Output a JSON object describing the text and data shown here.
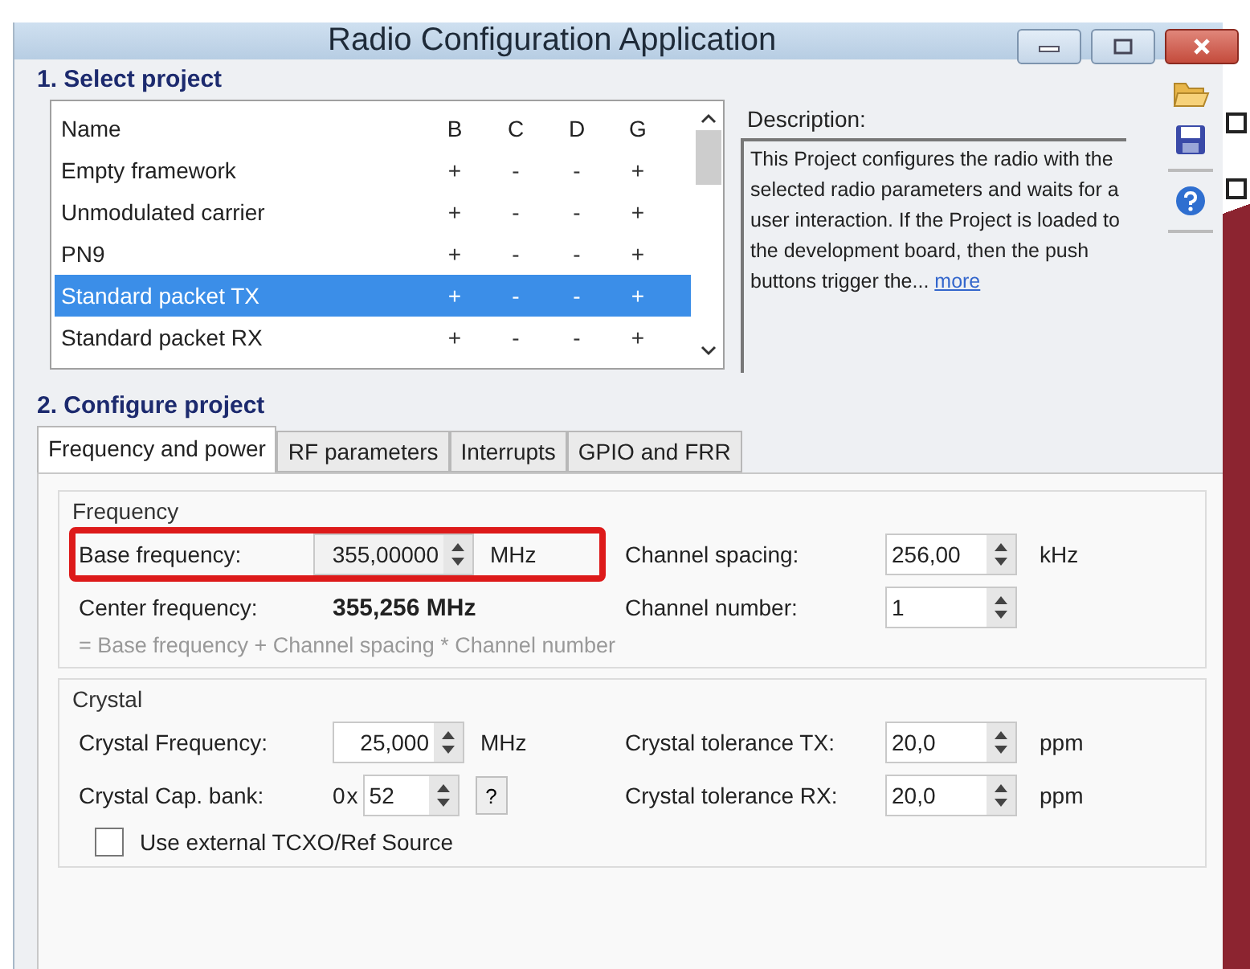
{
  "window": {
    "title": "Radio Configuration Application"
  },
  "select_project": {
    "title": "1. Select project",
    "columns": [
      "Name",
      "B",
      "C",
      "D",
      "G"
    ],
    "rows": [
      {
        "cells": [
          "Empty framework",
          "+",
          "-",
          "-",
          "+"
        ],
        "selected": false
      },
      {
        "cells": [
          "Unmodulated carrier",
          "+",
          "-",
          "-",
          "+"
        ],
        "selected": false
      },
      {
        "cells": [
          "PN9",
          "+",
          "-",
          "-",
          "+"
        ],
        "selected": false
      },
      {
        "cells": [
          "Standard packet TX",
          "+",
          "-",
          "-",
          "+"
        ],
        "selected": true
      },
      {
        "cells": [
          "Standard packet RX",
          "+",
          "-",
          "-",
          "+"
        ],
        "selected": false
      }
    ],
    "description_label": "Description:",
    "description": "This Project configures the radio with the selected radio parameters and waits for a user interaction. If the Project is loaded to the development board, then the push buttons trigger the...",
    "more_link": "more"
  },
  "configure_project": {
    "title": "2. Configure project",
    "tabs": [
      {
        "label": "Frequency and power",
        "selected": true
      },
      {
        "label": "RF parameters",
        "selected": false
      },
      {
        "label": "Interrupts",
        "selected": false
      },
      {
        "label": "GPIO and FRR",
        "selected": false
      }
    ],
    "frequency": {
      "title": "Frequency",
      "base_frequency": {
        "label": "Base frequency:",
        "value": "355,00000",
        "unit": "MHz",
        "highlighted": true
      },
      "channel_spacing": {
        "label": "Channel spacing:",
        "value": "256,00",
        "unit": "kHz"
      },
      "center_frequency": {
        "label": "Center frequency:",
        "value": "355,256 MHz"
      },
      "channel_number": {
        "label": "Channel number:",
        "value": "1"
      },
      "formula": "= Base frequency + Channel spacing * Channel number"
    },
    "crystal": {
      "title": "Crystal",
      "crystal_frequency": {
        "label": "Crystal Frequency:",
        "value": "25,000",
        "unit": "MHz"
      },
      "tolerance_tx": {
        "label": "Crystal tolerance TX:",
        "value": "20,0",
        "unit": "ppm"
      },
      "cap_bank": {
        "label": "Crystal Cap. bank:",
        "prefix": "0x",
        "value": "52",
        "help": "?"
      },
      "tolerance_rx": {
        "label": "Crystal tolerance RX:",
        "value": "20,0",
        "unit": "ppm"
      },
      "external_tcxo": {
        "label": "Use external TCXO/Ref Source",
        "checked": false
      }
    }
  }
}
